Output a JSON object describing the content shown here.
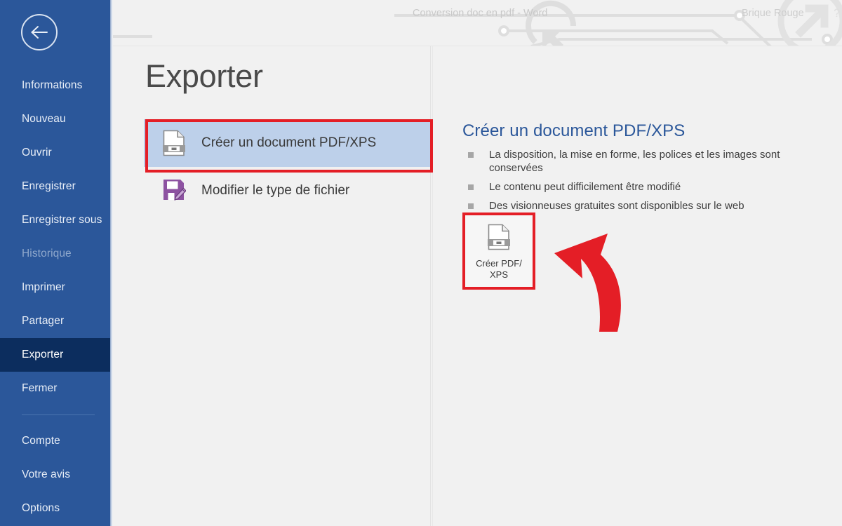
{
  "window": {
    "document_title": "Conversion doc en pdf  -  Word",
    "brand": "Brique Rouge",
    "help_icon": "?",
    "back_icon": "back-arrow-icon"
  },
  "sidebar": {
    "accent_color": "#2b579a",
    "active_color": "#0c2d5e",
    "items": [
      {
        "label": "Informations",
        "state": "normal"
      },
      {
        "label": "Nouveau",
        "state": "normal"
      },
      {
        "label": "Ouvrir",
        "state": "normal"
      },
      {
        "label": "Enregistrer",
        "state": "normal"
      },
      {
        "label": "Enregistrer sous",
        "state": "normal"
      },
      {
        "label": "Historique",
        "state": "disabled"
      },
      {
        "label": "Imprimer",
        "state": "normal"
      },
      {
        "label": "Partager",
        "state": "normal"
      },
      {
        "label": "Exporter",
        "state": "active"
      },
      {
        "label": "Fermer",
        "state": "normal"
      }
    ],
    "bottom_items": [
      {
        "label": "Compte"
      },
      {
        "label": "Votre avis"
      },
      {
        "label": "Options"
      }
    ]
  },
  "main": {
    "page_title": "Exporter",
    "options": [
      {
        "label": "Créer un document PDF/XPS",
        "icon": "pdf-document-icon",
        "selected": true,
        "highlighted": true
      },
      {
        "label": "Modifier le type de fichier",
        "icon": "floppy-disk-pencil-icon",
        "selected": false,
        "highlighted": false
      }
    ]
  },
  "detail": {
    "heading": "Créer un document PDF/XPS",
    "heading_color": "#2b579a",
    "bullets": [
      "La disposition, la mise en forme, les polices et les images sont conservées",
      "Le contenu peut difficilement être modifié",
      "Des visionneuses gratuites sont disponibles sur le web"
    ],
    "action": {
      "label_line1": "Créer PDF/",
      "label_line2": "XPS",
      "icon": "pdf-document-icon",
      "highlight_color": "#e41e26"
    }
  },
  "annotation": {
    "arrow_color": "#e41e26",
    "arrow_name": "curved-arrow-pointing-left"
  }
}
